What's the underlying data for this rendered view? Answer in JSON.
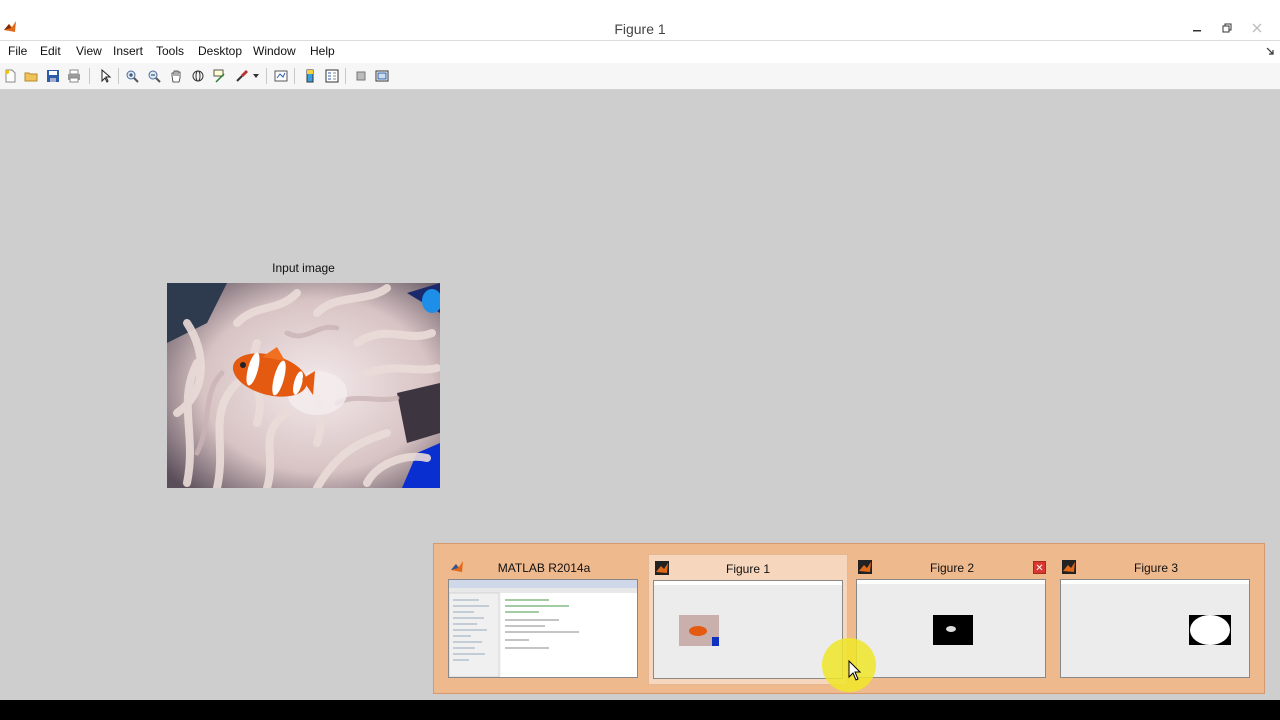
{
  "window": {
    "title": "Figure 1",
    "controls": [
      "minimize",
      "restore",
      "close"
    ]
  },
  "menu": [
    "File",
    "Edit",
    "View",
    "Insert",
    "Tools",
    "Desktop",
    "Window",
    "Help"
  ],
  "toolbar": {
    "buttons": [
      "new-figure",
      "open-file",
      "save-figure",
      "print-figure",
      "edit-plot",
      "zoom-in",
      "zoom-out",
      "pan",
      "rotate-3d",
      "data-cursor",
      "brush",
      "link-plot",
      "insert-colorbar",
      "insert-legend",
      "hide-plot-tools",
      "show-plot-tools"
    ]
  },
  "axes": {
    "title": "Input image"
  },
  "taskbar_preview": {
    "items": [
      {
        "label": "MATLAB R2014a",
        "icon": "matlab-icon",
        "active": false
      },
      {
        "label": "Figure 1",
        "icon": "matlab-figure-icon",
        "active": true
      },
      {
        "label": "Figure 2",
        "icon": "matlab-figure-icon",
        "active": false,
        "close_glyph": "✕"
      },
      {
        "label": "Figure 3",
        "icon": "matlab-figure-icon",
        "active": false
      }
    ]
  },
  "colors": {
    "figure_background": "#cecece",
    "preview_background": "#efb98e",
    "active_thumb": "#f6d6bd",
    "cursor_highlight": "#f0e628"
  }
}
